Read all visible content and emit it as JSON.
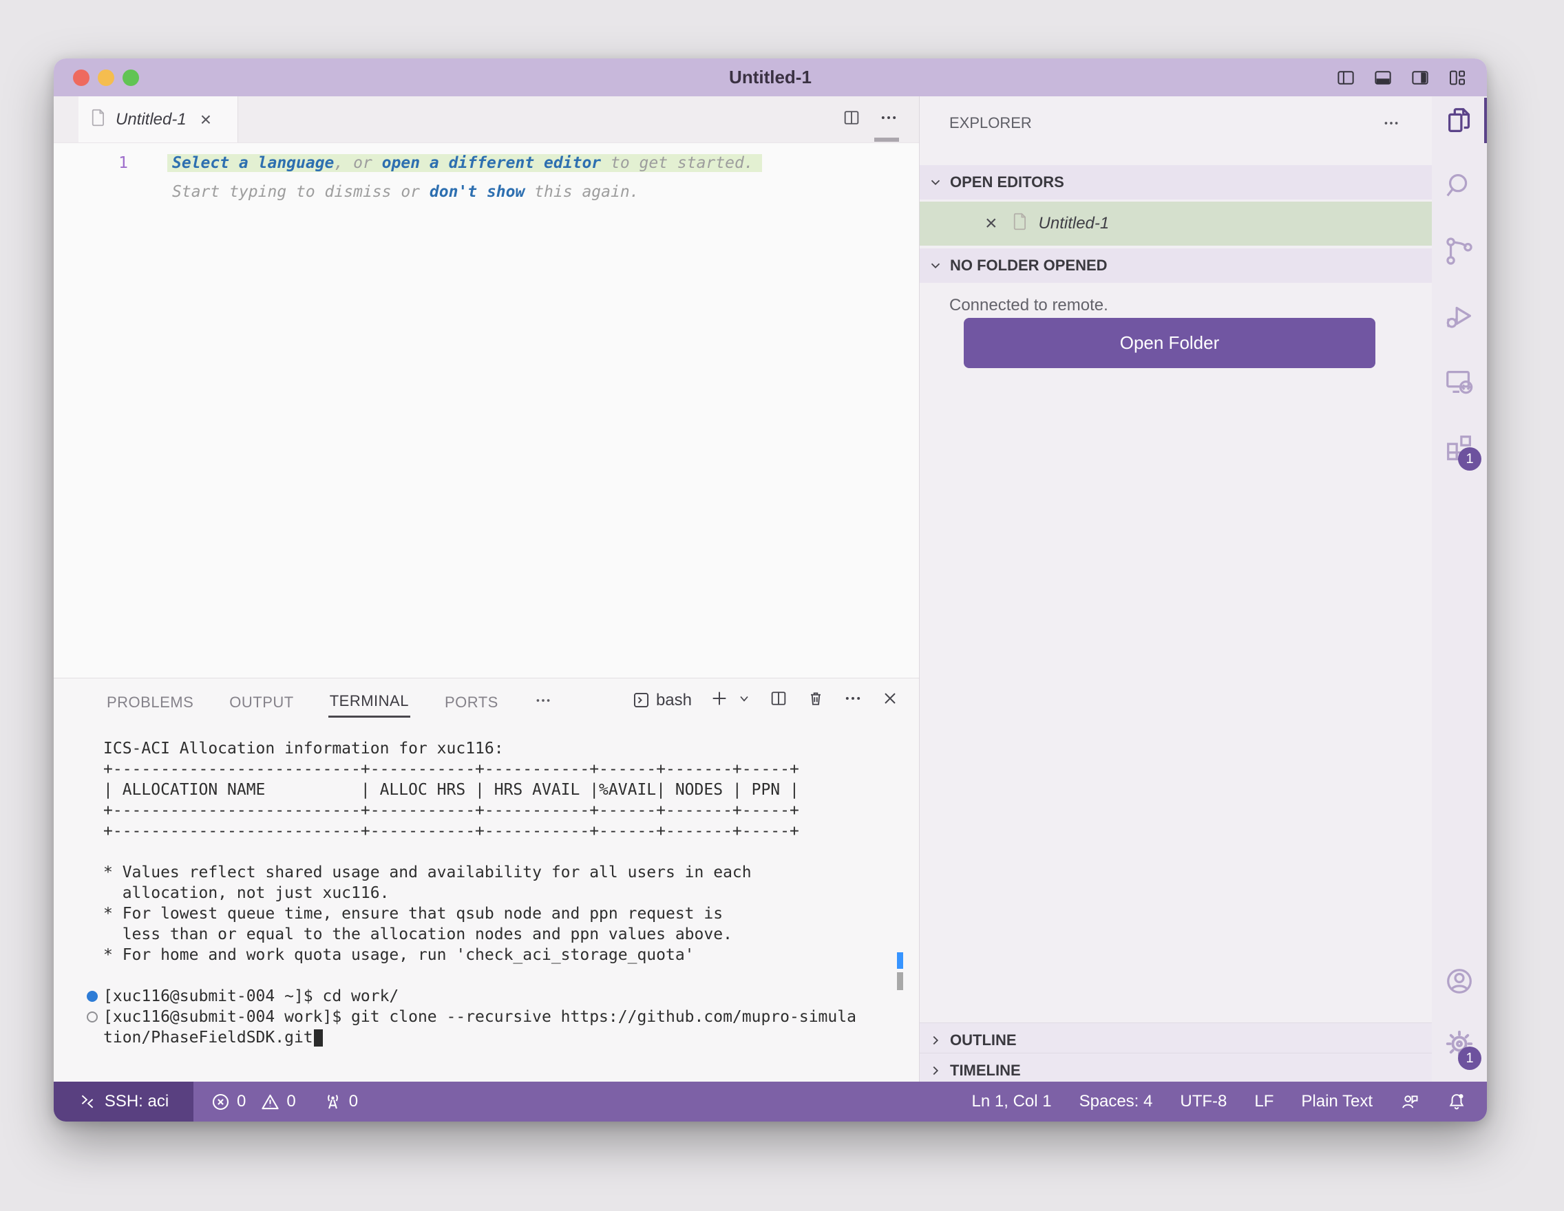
{
  "window": {
    "title": "Untitled-1"
  },
  "titlebar": {
    "icons": [
      "toggle-primary-sidebar-icon",
      "toggle-panel-icon",
      "toggle-secondary-sidebar-icon",
      "customize-layout-icon"
    ]
  },
  "tab": {
    "label": "Untitled-1",
    "close": "×"
  },
  "editor": {
    "line_number": "1",
    "line1": {
      "link1": "Select a language",
      "mid1": ", or ",
      "link2": "open a different editor",
      "end": " to get started."
    },
    "line2": {
      "pre": "Start typing to dismiss or ",
      "link": "don't show",
      "end": " this again."
    }
  },
  "panel": {
    "tabs": [
      "PROBLEMS",
      "OUTPUT",
      "TERMINAL",
      "PORTS"
    ],
    "more": "⋯",
    "terminal_label": "bash",
    "close": "×"
  },
  "terminal": {
    "lines": [
      "ICS-ACI Allocation information for xuc116:",
      "+--------------------------+-----------+-----------+------+-------+-----+",
      "| ALLOCATION NAME          | ALLOC HRS | HRS AVAIL |%AVAIL| NODES | PPN |",
      "+--------------------------+-----------+-----------+------+-------+-----+",
      "+--------------------------+-----------+-----------+------+-------+-----+",
      "",
      "* Values reflect shared usage and availability for all users in each",
      "  allocation, not just xuc116.",
      "* For lowest queue time, ensure that qsub node and ppn request is",
      "  less than or equal to the allocation nodes and ppn values above.",
      "* For home and work quota usage, run 'check_aci_storage_quota'",
      "",
      "[xuc116@submit-004 ~]$ cd work/",
      "[xuc116@submit-004 work]$ git clone --recursive https://github.com/mupro-simula",
      "tion/PhaseFieldSDK.git"
    ]
  },
  "sidebar": {
    "title": "EXPLORER",
    "open_editors": "OPEN EDITORS",
    "open_editor_item": "Untitled-1",
    "item_close": "×",
    "no_folder": "NO FOLDER OPENED",
    "connected_text": "Connected to remote.",
    "open_folder_button": "Open Folder",
    "outline": "OUTLINE",
    "timeline": "TIMELINE"
  },
  "activity_bar": {
    "icons": [
      "explorer-icon",
      "search-icon",
      "source-control-icon",
      "run-debug-icon",
      "remote-explorer-icon",
      "extensions-icon",
      "account-icon",
      "manage-gear-icon"
    ],
    "extensions_badge": "1",
    "manage_badge": "1"
  },
  "status_bar": {
    "remote": "SSH: aci",
    "errors": "0",
    "warnings": "0",
    "ports": "0",
    "cursor_position": "Ln 1, Col 1",
    "indentation": "Spaces: 4",
    "encoding": "UTF-8",
    "eol": "LF",
    "language": "Plain Text"
  },
  "colors": {
    "titlebar": "#c8b8db",
    "accent_button": "#7156a2",
    "status_bar": "#7d61a6",
    "status_remote": "#594080",
    "highlight_line": "#e3f0d2",
    "selected_item": "#d5e0cd",
    "link_blue": "#2d6fb0",
    "line_number": "#9d6ccb",
    "activity_icon_active": "#5b4389",
    "activity_icon_inactive": "#b2a2c8",
    "terminal_decoration_success": "#2e7cd6"
  }
}
